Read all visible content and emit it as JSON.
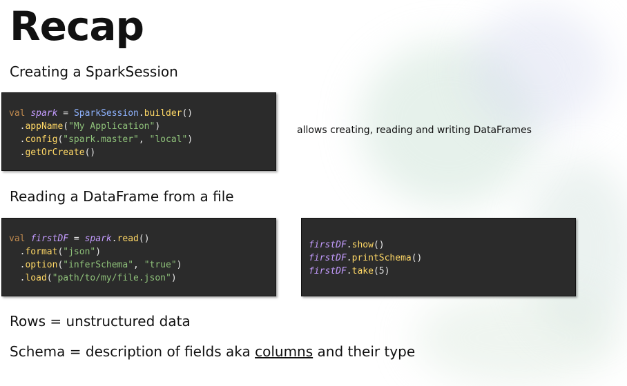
{
  "title": "Recap",
  "sections": {
    "session_heading": "Creating a SparkSession",
    "reading_heading": "Reading a DataFrame from a file",
    "rows_line": "Rows = unstructured data",
    "schema_line_prefix": "Schema = description of fields aka ",
    "schema_line_link": "columns",
    "schema_line_suffix": " and their type"
  },
  "session_description": "allows creating, reading and writing DataFrames",
  "code": {
    "session": {
      "kw": "val",
      "var": "spark",
      "eq": " = ",
      "cls": "SparkSession",
      "dot1": ".",
      "builder": "builder",
      "builder_parens": "()",
      "l2_dot": "  .",
      "l2_fn": "appName",
      "l2_open": "(",
      "l2_arg": "\"My Application\"",
      "l2_close": ")",
      "l3_dot": "  .",
      "l3_fn": "config",
      "l3_open": "(",
      "l3_arg1": "\"spark.master\"",
      "l3_sep": ", ",
      "l3_arg2": "\"local\"",
      "l3_close": ")",
      "l4_dot": "  .",
      "l4_fn": "getOrCreate",
      "l4_parens": "()"
    },
    "read": {
      "kw": "val",
      "var": "firstDF",
      "eq": " = ",
      "spark": "spark",
      "dot1": ".",
      "read": "read",
      "read_parens": "()",
      "l2_dot": "  .",
      "l2_fn": "format",
      "l2_open": "(",
      "l2_arg": "\"json\"",
      "l2_close": ")",
      "l3_dot": "  .",
      "l3_fn": "option",
      "l3_open": "(",
      "l3_arg1": "\"inferSchema\"",
      "l3_sep": ", ",
      "l3_arg2": "\"true\"",
      "l3_close": ")",
      "l4_dot": "  .",
      "l4_fn": "load",
      "l4_open": "(",
      "l4_arg": "\"path/to/my/file.json\"",
      "l4_close": ")"
    },
    "actions": {
      "var": "firstDF",
      "dot": ".",
      "show": "show",
      "show_parens": "()",
      "printSchema": "printSchema",
      "print_parens": "()",
      "take": "take",
      "take_open": "(",
      "take_arg": "5",
      "take_close": ")"
    }
  },
  "colors": {
    "code_bg": "#2b2b2b",
    "keyword": "#c08a4e",
    "variable": "#c49cff",
    "class": "#8fb3ff",
    "function": "#ffd866",
    "string": "#8fc27a"
  }
}
